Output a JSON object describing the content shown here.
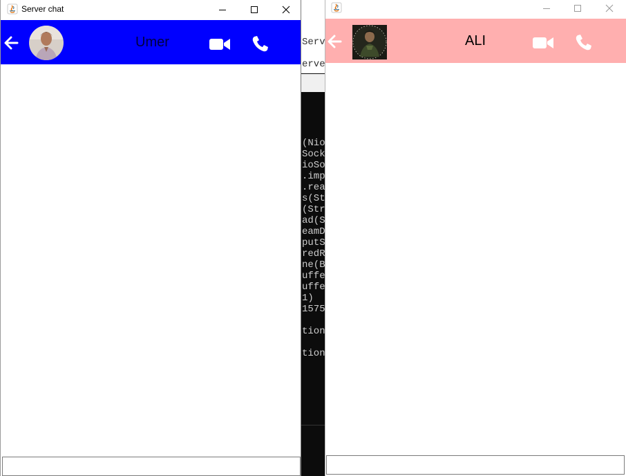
{
  "left_window": {
    "title": "Server chat",
    "header_color": "#0000ff",
    "contact_name": "Umer",
    "message_input": {
      "value": "",
      "placeholder": ""
    },
    "icons": {
      "app": "java-icon",
      "back": "back-arrow-icon",
      "avatar": "avatar",
      "video": "video-camera-icon",
      "phone": "phone-icon",
      "minimize": "minimize-icon",
      "maximize": "maximize-icon",
      "close": "close-icon"
    }
  },
  "right_window": {
    "title": "",
    "header_color": "#ffafaf",
    "contact_name": "ALI",
    "message_input": {
      "value": "",
      "placeholder": ""
    },
    "icons": {
      "app": "java-icon",
      "back": "back-arrow-icon",
      "avatar": "avatar",
      "video": "video-camera-icon",
      "phone": "phone-icon",
      "minimize": "minimize-icon",
      "maximize": "maximize-icon",
      "close": "close-icon"
    }
  },
  "terminal": {
    "header_lines": [
      "Serve",
      "erve"
    ],
    "lines": [
      "(Nio",
      "Sock",
      "ioSo",
      ".imp",
      ".rea",
      "s(St",
      "(Str",
      "ad(S",
      "eamD",
      "putS",
      "redR",
      "ne(B",
      "uffe",
      "uffe",
      "1)",
      "1575",
      "",
      "tion",
      "",
      "tion"
    ]
  }
}
